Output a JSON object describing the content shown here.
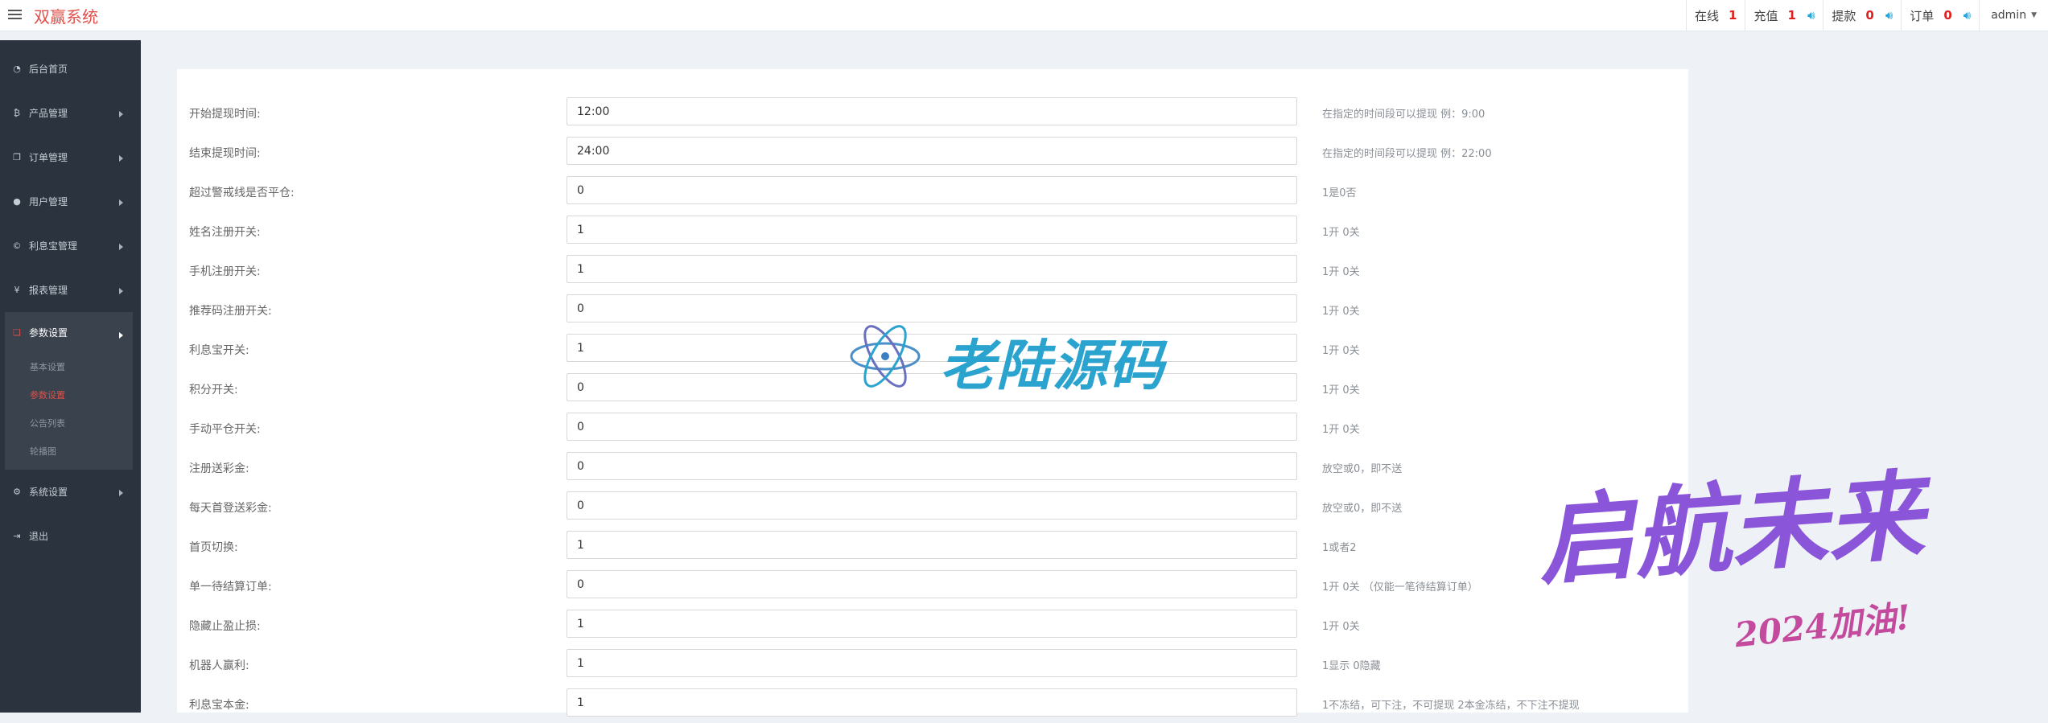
{
  "header": {
    "brand": "双赢系统",
    "stats": [
      {
        "label": "在线",
        "count": "1"
      },
      {
        "label": "充值",
        "count": "1"
      },
      {
        "label": "提款",
        "count": "0"
      },
      {
        "label": "订单",
        "count": "0"
      }
    ],
    "user": "admin"
  },
  "sidebar": {
    "items": [
      {
        "label": "后台首页",
        "icon": "dashboard-icon"
      },
      {
        "label": "产品管理",
        "icon": "bitcoin-icon"
      },
      {
        "label": "订单管理",
        "icon": "copy-icon"
      },
      {
        "label": "用户管理",
        "icon": "user-icon"
      },
      {
        "label": "利息宝管理",
        "icon": "copyright-icon"
      },
      {
        "label": "报表管理",
        "icon": "yen-icon"
      },
      {
        "label": "参数设置",
        "icon": "files-icon"
      },
      {
        "label": "系统设置",
        "icon": "gears-icon"
      },
      {
        "label": "退出",
        "icon": "sign-out-icon"
      }
    ],
    "sub_items": [
      "基本设置",
      "参数设置",
      "公告列表",
      "轮播图"
    ]
  },
  "form": {
    "rows": [
      {
        "label": "开始提现时间:",
        "value": "12:00",
        "hint": "在指定的时间段可以提现 例：9:00"
      },
      {
        "label": "结束提现时间:",
        "value": "24:00",
        "hint": "在指定的时间段可以提现 例：22:00"
      },
      {
        "label": "超过警戒线是否平仓:",
        "value": "0",
        "hint": "1是0否"
      },
      {
        "label": "姓名注册开关:",
        "value": "1",
        "hint": "1开 0关"
      },
      {
        "label": "手机注册开关:",
        "value": "1",
        "hint": "1开 0关"
      },
      {
        "label": "推荐码注册开关:",
        "value": "0",
        "hint": "1开 0关"
      },
      {
        "label": "利息宝开关:",
        "value": "1",
        "hint": "1开 0关"
      },
      {
        "label": "积分开关:",
        "value": "0",
        "hint": "1开 0关"
      },
      {
        "label": "手动平仓开关:",
        "value": "0",
        "hint": "1开 0关"
      },
      {
        "label": "注册送彩金:",
        "value": "0",
        "hint": "放空或0，即不送"
      },
      {
        "label": "每天首登送彩金:",
        "value": "0",
        "hint": "放空或0，即不送"
      },
      {
        "label": "首页切换:",
        "value": "1",
        "hint": "1或者2"
      },
      {
        "label": "单一待结算订单:",
        "value": "0",
        "hint": "1开 0关 （仅能一笔待结算订单）"
      },
      {
        "label": "隐藏止盈止损:",
        "value": "1",
        "hint": "1开 0关"
      },
      {
        "label": "机器人赢利:",
        "value": "1",
        "hint": "1显示 0隐藏"
      },
      {
        "label": "利息宝本金:",
        "value": "1",
        "hint": "1不冻结，可下注，不可提现 2本金冻结，不下注不提现"
      }
    ]
  },
  "watermarks": {
    "logo_text": "老陆源码",
    "slogan": "启航未来",
    "slogan_sub": "2024加油!"
  }
}
